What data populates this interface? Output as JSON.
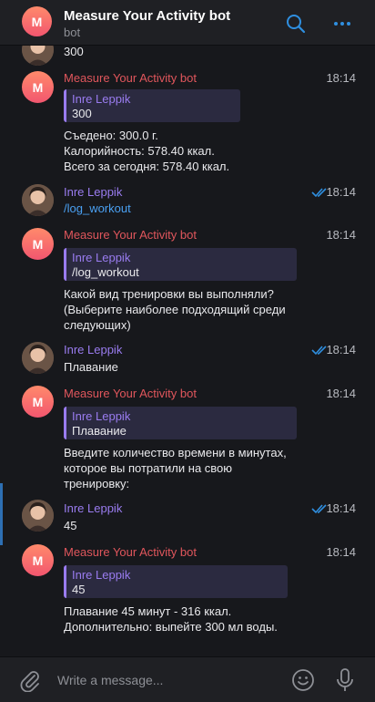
{
  "header": {
    "avatar_letter": "M",
    "title": "Measure Your Activity bot",
    "subtitle": "bot",
    "search_icon": "search-icon",
    "more_icon": "more-options-icon"
  },
  "partial": {
    "text": "300"
  },
  "messages": [
    {
      "sender": "Measure Your Activity bot",
      "avatar": "M",
      "time": "18:14",
      "quote": {
        "name": "Inre Leppik",
        "text": "300"
      },
      "text": "Съедено: 300.0 г.\nКалорийность: 578.40 ккал.\nВсего за сегодня: 578.40 ккал."
    },
    {
      "sender": "Inre Leppik",
      "time": "18:14",
      "read": true,
      "text": "/log_workout"
    },
    {
      "sender": "Measure Your Activity bot",
      "avatar": "M",
      "time": "18:14",
      "quote": {
        "name": "Inre Leppik",
        "text": "/log_workout"
      },
      "text": "Какой вид тренировки вы выполняли?\n(Выберите наиболее подходящий среди\nследующих)"
    },
    {
      "sender": "Inre Leppik",
      "time": "18:14",
      "read": true,
      "text": "Плавание"
    },
    {
      "sender": "Measure Your Activity bot",
      "avatar": "M",
      "time": "18:14",
      "quote": {
        "name": "Inre Leppik",
        "text": "Плавание"
      },
      "text": "Введите количество времени в минутах,\nкоторое вы потратили на свою\nтренировку:"
    },
    {
      "sender": "Inre Leppik",
      "time": "18:14",
      "read": true,
      "text": "45"
    },
    {
      "sender": "Measure Your Activity bot",
      "avatar": "M",
      "time": "18:14",
      "quote": {
        "name": "Inre Leppik",
        "text": "45"
      },
      "text": "Плавание 45 минут - 316 ккал.\nДополнительно: выпейте 300 мл воды."
    }
  ],
  "composer": {
    "placeholder": "Write a message...",
    "attach_icon": "paperclip-icon",
    "emoji_icon": "emoji-icon",
    "mic_icon": "microphone-icon"
  },
  "colors": {
    "bg": "#17181c",
    "panel": "#1f2024",
    "bot_name": "#e0565c",
    "user_name": "#9a7cf0",
    "accent": "#2f8fe0",
    "link": "#4aa0f2"
  }
}
